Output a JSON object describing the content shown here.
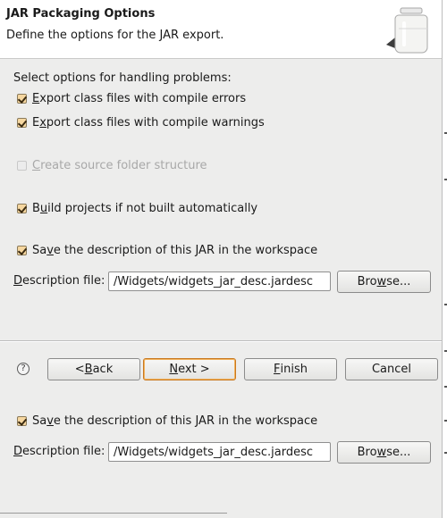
{
  "banner": {
    "title": "JAR Packaging Options",
    "description": "Define the options for the JAR export."
  },
  "options": {
    "section_label": "Select options for handling problems:",
    "export_errors": {
      "pre": "",
      "ul": "E",
      "post": "xport class files with compile errors",
      "checked": true
    },
    "export_warnings": {
      "pre": "E",
      "ul": "x",
      "post": "port class files with compile warnings",
      "checked": true
    },
    "create_source_folder": {
      "pre": "",
      "ul": "C",
      "post": "reate source folder structure",
      "checked": false,
      "enabled": false
    },
    "build_projects": {
      "pre": "B",
      "ul": "u",
      "post": "ild projects if not built automatically",
      "checked": true
    },
    "save_description": {
      "pre": "Sa",
      "ul": "v",
      "post": "e the description of this JAR in the workspace",
      "checked": true
    }
  },
  "description_file": {
    "label_pre": "",
    "label_ul": "D",
    "label_post": "escription file:",
    "value": "/Widgets/widgets_jar_desc.jardesc",
    "browse_pre": "Bro",
    "browse_ul": "w",
    "browse_post": "se..."
  },
  "buttons": {
    "help": "?",
    "back_pre": "< ",
    "back_ul": "B",
    "back_post": "ack",
    "next_ul": "N",
    "next_post": "ext >",
    "finish_ul": "F",
    "finish_post": "inish",
    "cancel": "Cancel"
  },
  "colors": {
    "checkbox_fill": "#f6d7a0",
    "default_button_border": "#c9781e",
    "background": "#ededec"
  }
}
